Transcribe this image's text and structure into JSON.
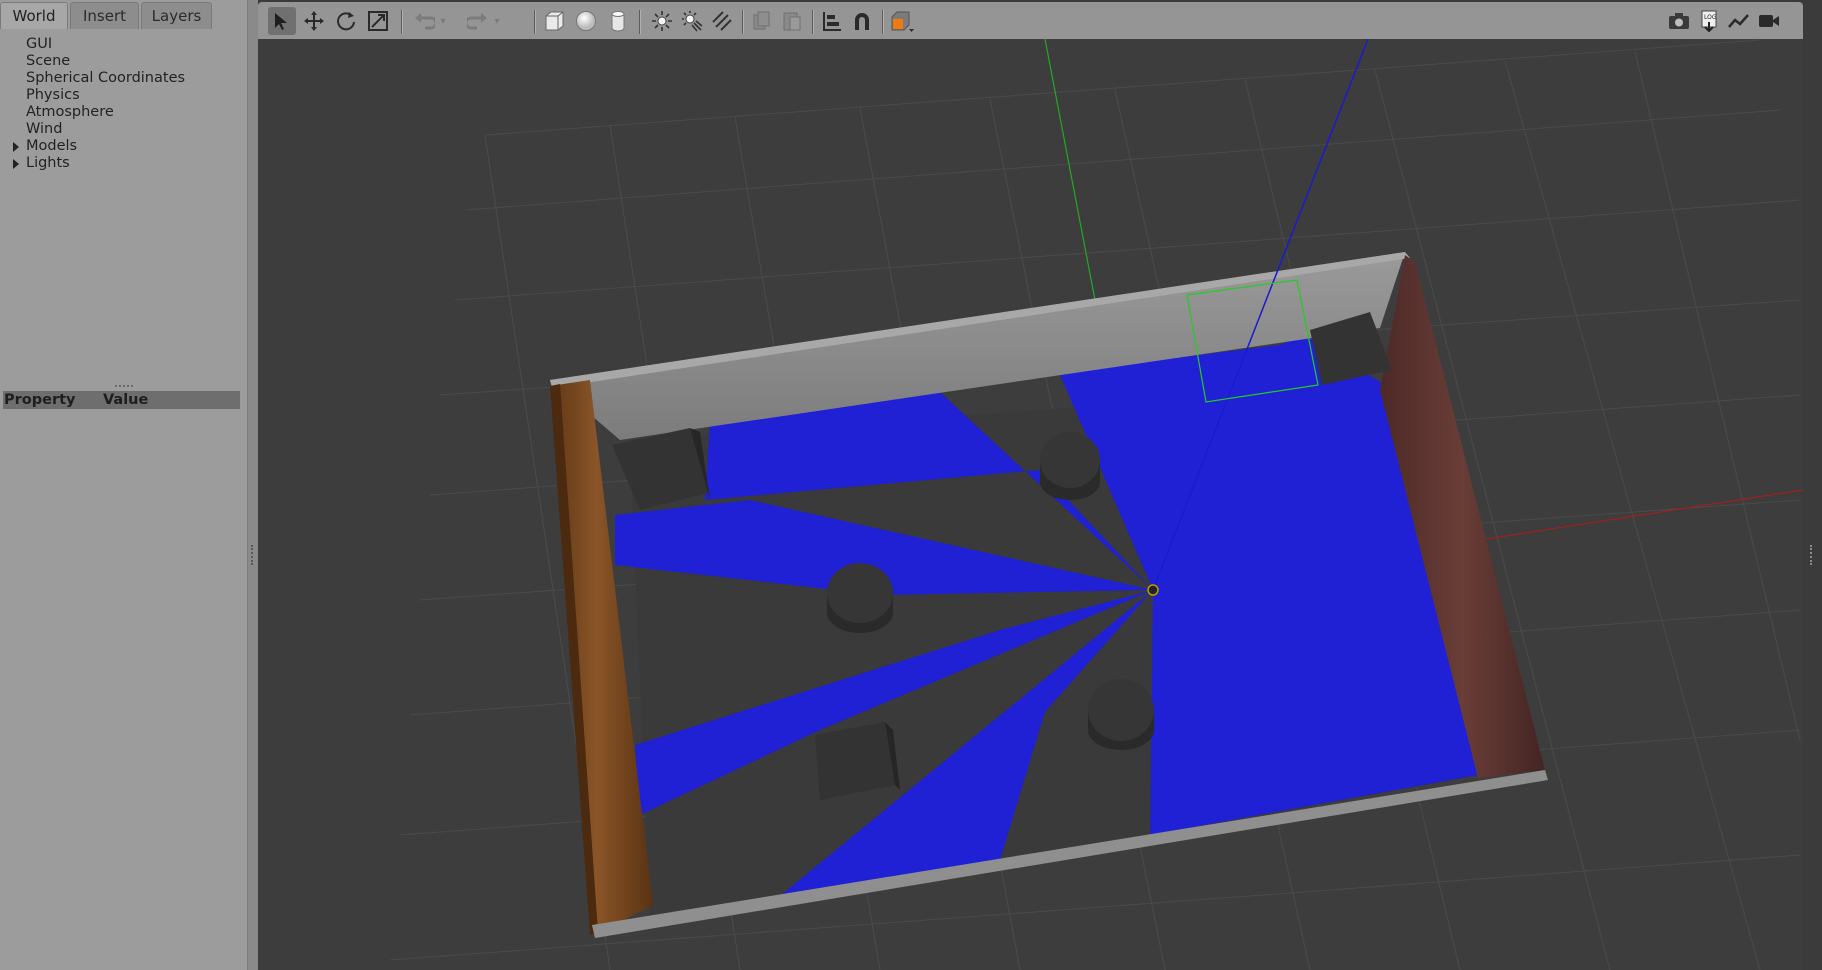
{
  "tabs": [
    {
      "label": "World",
      "active": true
    },
    {
      "label": "Insert",
      "active": false
    },
    {
      "label": "Layers",
      "active": false
    }
  ],
  "world_tree": [
    {
      "label": "GUI",
      "expandable": false
    },
    {
      "label": "Scene",
      "expandable": false
    },
    {
      "label": "Spherical Coordinates",
      "expandable": false
    },
    {
      "label": "Physics",
      "expandable": false
    },
    {
      "label": "Atmosphere",
      "expandable": false
    },
    {
      "label": "Wind",
      "expandable": false
    },
    {
      "label": "Models",
      "expandable": true
    },
    {
      "label": "Lights",
      "expandable": true
    }
  ],
  "property_table": {
    "property_header": "Property",
    "value_header": "Value"
  },
  "toolbar": {
    "tools": [
      {
        "name": "select-mode",
        "icon": "arrow-pointer-icon",
        "selected": true
      },
      {
        "name": "translate-mode",
        "icon": "move-arrows-icon"
      },
      {
        "name": "rotate-mode",
        "icon": "rotate-icon"
      },
      {
        "name": "scale-mode",
        "icon": "scale-icon"
      },
      {
        "name": "undo",
        "icon": "undo-icon",
        "disabled": true
      },
      {
        "name": "redo",
        "icon": "redo-icon",
        "disabled": true
      },
      {
        "name": "box-shape",
        "icon": "box-icon"
      },
      {
        "name": "sphere-shape",
        "icon": "sphere-icon"
      },
      {
        "name": "cylinder-shape",
        "icon": "cylinder-icon"
      },
      {
        "name": "point-light",
        "icon": "point-light-icon"
      },
      {
        "name": "spot-light",
        "icon": "spot-light-icon"
      },
      {
        "name": "directional-light",
        "icon": "directional-light-icon"
      },
      {
        "name": "copy",
        "icon": "copy-icon",
        "disabled": true
      },
      {
        "name": "paste",
        "icon": "paste-icon",
        "disabled": true
      },
      {
        "name": "align",
        "icon": "align-icon"
      },
      {
        "name": "snap",
        "icon": "magnet-icon"
      },
      {
        "name": "view-angle",
        "icon": "view-angle-icon"
      },
      {
        "name": "screenshot",
        "icon": "camera-icon"
      },
      {
        "name": "log",
        "icon": "log-icon"
      },
      {
        "name": "plot",
        "icon": "plot-icon"
      },
      {
        "name": "video-record",
        "icon": "video-camera-icon"
      }
    ]
  },
  "colors": {
    "laser": "#1f1fd6",
    "floor_grid": "#4a4a4a",
    "wall_gray": "#8f8f8f",
    "wall_wood": "#7a4a22",
    "wall_brick": "#5a3330",
    "obstacle": "#2f2f2f",
    "axis_x": "#b22222",
    "axis_y": "#22aa22",
    "axis_z": "#2222cc",
    "selection_box": "#22dd22"
  }
}
